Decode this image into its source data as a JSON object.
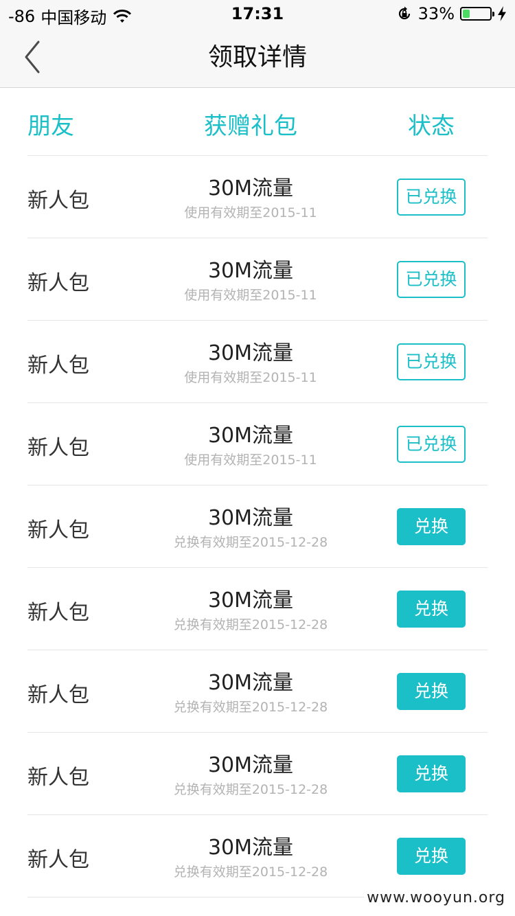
{
  "status_bar": {
    "signal": "-86",
    "carrier": "中国移动",
    "time": "17:31",
    "battery_percent": "33%",
    "battery_level": 0.33,
    "icons": [
      "wifi-icon",
      "orientation-lock-icon",
      "battery-icon",
      "charging-bolt-icon"
    ]
  },
  "nav": {
    "title": "领取详情",
    "back_icon": "chevron-left-icon"
  },
  "table": {
    "headers": {
      "friend": "朋友",
      "gift": "获赠礼包",
      "status": "状态"
    },
    "rows": [
      {
        "name": "新人包",
        "gift": "30M流量",
        "expiry": "使用有效期至2015-11",
        "status": "已兑换"
      },
      {
        "name": "新人包",
        "gift": "30M流量",
        "expiry": "使用有效期至2015-11",
        "status": "已兑换"
      },
      {
        "name": "新人包",
        "gift": "30M流量",
        "expiry": "使用有效期至2015-11",
        "status": "已兑换"
      },
      {
        "name": "新人包",
        "gift": "30M流量",
        "expiry": "使用有效期至2015-11",
        "status": "已兑换"
      },
      {
        "name": "新人包",
        "gift": "30M流量",
        "expiry": "兑换有效期至2015-12-28",
        "status": "兑换"
      },
      {
        "name": "新人包",
        "gift": "30M流量",
        "expiry": "兑换有效期至2015-12-28",
        "status": "兑换"
      },
      {
        "name": "新人包",
        "gift": "30M流量",
        "expiry": "兑换有效期至2015-12-28",
        "status": "兑换"
      },
      {
        "name": "新人包",
        "gift": "30M流量",
        "expiry": "兑换有效期至2015-12-28",
        "status": "兑换"
      },
      {
        "name": "新人包",
        "gift": "30M流量",
        "expiry": "兑换有效期至2015-12-28",
        "status": "兑换"
      }
    ]
  },
  "watermark": "www.wooyun.org",
  "colors": {
    "accent": "#1bbfc8",
    "nav_background": "#f7f7f7",
    "divider": "#e6e6e6",
    "secondary_text": "#b3b3b3",
    "battery_fill": "#4cd964"
  }
}
